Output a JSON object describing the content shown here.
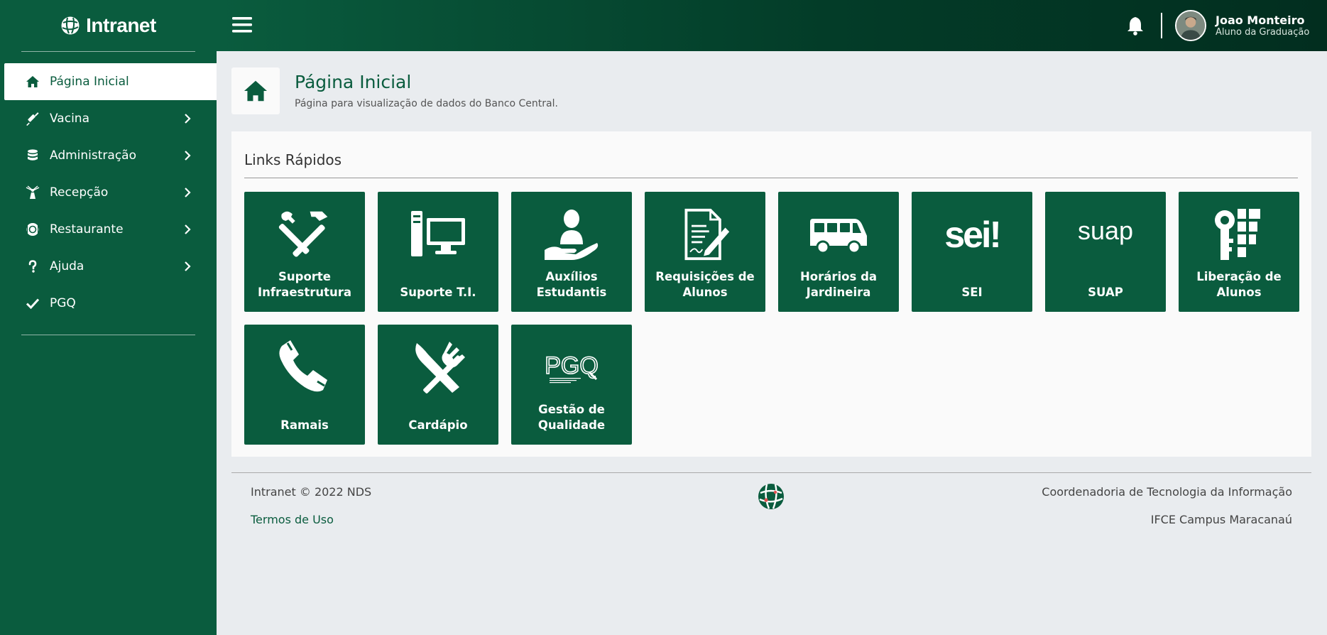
{
  "brand": {
    "name": "Intranet"
  },
  "sidebar": {
    "items": [
      {
        "label": "Página Inicial",
        "icon": "home-icon",
        "active": true
      },
      {
        "label": "Vacina",
        "icon": "syringe-icon",
        "has_submenu": true
      },
      {
        "label": "Administração",
        "icon": "database-icon",
        "has_submenu": true
      },
      {
        "label": "Recepção",
        "icon": "concierge-icon",
        "has_submenu": true
      },
      {
        "label": "Restaurante",
        "icon": "plate-icon",
        "has_submenu": true
      },
      {
        "label": "Ajuda",
        "icon": "question-icon",
        "has_submenu": true
      },
      {
        "label": "PGQ",
        "icon": "check-icon"
      }
    ]
  },
  "topbar": {
    "user_name": "Joao Monteiro",
    "user_role": "Aluno da Graduação"
  },
  "page": {
    "title": "Página Inicial",
    "subtitle": "Página para visualização de dados do Banco Central."
  },
  "quick_links": {
    "title": "Links Rápidos",
    "tiles": [
      {
        "label": "Suporte Infraestrutura",
        "icon": "tools-icon"
      },
      {
        "label": "Suporte T.I.",
        "icon": "computer-icon"
      },
      {
        "label": "Auxílios Estudantis",
        "icon": "student-aid-icon"
      },
      {
        "label": "Requisições de Alunos",
        "icon": "document-signature-icon"
      },
      {
        "label": "Horários da Jardineira",
        "icon": "bus-icon"
      },
      {
        "label": "SEI",
        "icon": "sei-logo-icon",
        "logo_text": "sei!"
      },
      {
        "label": "SUAP",
        "icon": "suap-logo-icon",
        "logo_text": "suap"
      },
      {
        "label": "Liberação de Alunos",
        "icon": "ifce-key-icon"
      },
      {
        "label": "Ramais",
        "icon": "phone-icon"
      },
      {
        "label": "Cardápio",
        "icon": "utensils-icon"
      },
      {
        "label": "Gestão de Qualidade",
        "icon": "pgq-logo-icon",
        "logo_text": "PGQ"
      }
    ]
  },
  "footer": {
    "copyright": "Intranet © 2022 NDS",
    "terms": "Termos de Uso",
    "dept": "Coordenadoria de Tecnologia da Informação",
    "campus": "IFCE Campus Maracanaú"
  },
  "colors": {
    "primary": "#0a5c3e",
    "topbar_dark": "#022e1f",
    "background": "#e9ecef",
    "card": "#fafafa"
  }
}
